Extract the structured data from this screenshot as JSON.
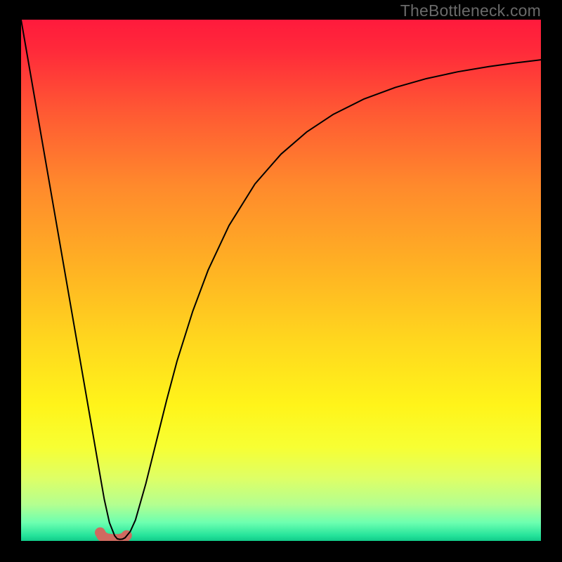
{
  "watermark": "TheBottleneck.com",
  "chart_data": {
    "type": "line",
    "title": "",
    "xlabel": "",
    "ylabel": "",
    "xlim": [
      0,
      100
    ],
    "ylim": [
      0,
      100
    ],
    "grid": false,
    "legend": false,
    "background_gradient": {
      "stops": [
        {
          "offset": 0.0,
          "color": "#ff1a3c"
        },
        {
          "offset": 0.06,
          "color": "#ff2a3a"
        },
        {
          "offset": 0.18,
          "color": "#ff5a33"
        },
        {
          "offset": 0.32,
          "color": "#ff8a2c"
        },
        {
          "offset": 0.48,
          "color": "#ffb323"
        },
        {
          "offset": 0.62,
          "color": "#ffd81e"
        },
        {
          "offset": 0.74,
          "color": "#fff41a"
        },
        {
          "offset": 0.82,
          "color": "#f7ff33"
        },
        {
          "offset": 0.88,
          "color": "#deff66"
        },
        {
          "offset": 0.93,
          "color": "#b4ff90"
        },
        {
          "offset": 0.965,
          "color": "#6cffb0"
        },
        {
          "offset": 0.99,
          "color": "#24e39a"
        },
        {
          "offset": 1.0,
          "color": "#11c988"
        }
      ]
    },
    "series": [
      {
        "name": "curve",
        "color": "#000000",
        "stroke_width": 2,
        "x": [
          0.0,
          2,
          4,
          6,
          8,
          10,
          12,
          14,
          15,
          16,
          17,
          18,
          18.5,
          19,
          19.5,
          20,
          21,
          22,
          24,
          26,
          28,
          30,
          33,
          36,
          40,
          45,
          50,
          55,
          60,
          66,
          72,
          78,
          84,
          90,
          95,
          100
        ],
        "y": [
          100,
          88.5,
          77,
          65.5,
          54,
          42.5,
          31,
          19.5,
          13.7,
          8,
          3.5,
          1.0,
          0.4,
          0.3,
          0.35,
          0.6,
          1.8,
          4.0,
          11,
          19,
          27,
          34.5,
          44,
          52,
          60.5,
          68.5,
          74.2,
          78.5,
          81.8,
          84.8,
          87.0,
          88.7,
          90.0,
          91.0,
          91.7,
          92.3
        ]
      }
    ],
    "marker": {
      "name": "min-marker",
      "color": "#cf6a60",
      "points_xy": [
        [
          15.2,
          1.6
        ],
        [
          15.6,
          0.9
        ],
        [
          16.4,
          0.45
        ],
        [
          17.6,
          0.3
        ],
        [
          18.8,
          0.3
        ],
        [
          19.8,
          0.55
        ],
        [
          20.3,
          1.05
        ]
      ],
      "stroke_width": 15,
      "linecap": "round"
    }
  }
}
